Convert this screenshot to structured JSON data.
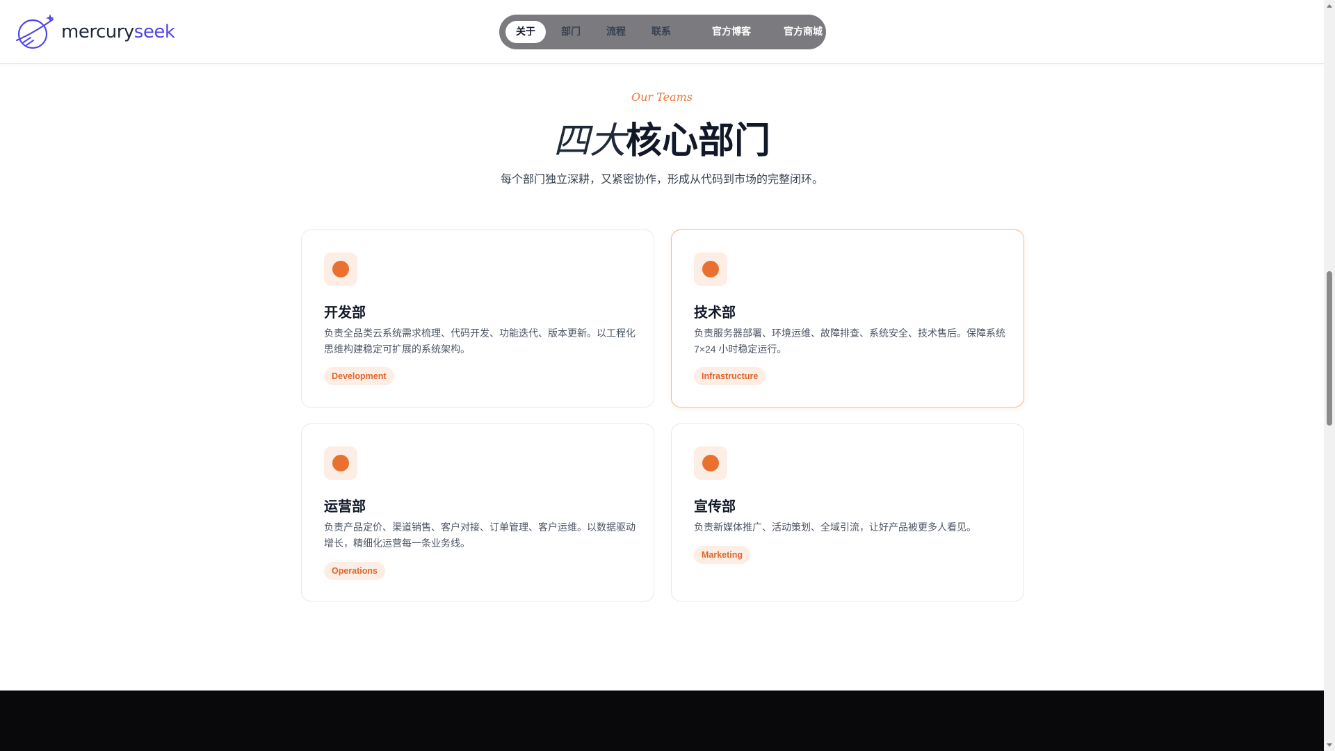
{
  "brand": {
    "name_part1": "mercury",
    "name_part2": "seek"
  },
  "nav": {
    "items": [
      "关于",
      "部门",
      "流程",
      "联系"
    ],
    "links": [
      "官方博客",
      "官方商城"
    ]
  },
  "section": {
    "eyebrow": "Our Teams",
    "title_light": "四大",
    "title_bold": "核心部门",
    "subtitle": "每个部门独立深耕，又紧密协作，形成从代码到市场的完整闭环。"
  },
  "cards": [
    {
      "title": "开发部",
      "description": "负责全品类云系统需求梳理、代码开发、功能迭代、版本更新。以工程化思维构建稳定可扩展的系统架构。",
      "tag": "Development"
    },
    {
      "title": "技术部",
      "description": "负责服务器部署、环境运维、故障排查、系统安全、技术售后。保障系统 7×24 小时稳定运行。",
      "tag": "Infrastructure"
    },
    {
      "title": "运营部",
      "description": "负责产品定价、渠道销售、客户对接、订单管理、客户运维。以数据驱动增长，精细化运营每一条业务线。",
      "tag": "Operations"
    },
    {
      "title": "宣传部",
      "description": "负责新媒体推广、活动策划、全域引流，让好产品被更多人看见。",
      "tag": "Marketing"
    }
  ],
  "colors": {
    "accent": "#e9702f",
    "accent_light": "#fdeee5",
    "brand_blue": "#4f46e5",
    "footer": "#09090b"
  }
}
